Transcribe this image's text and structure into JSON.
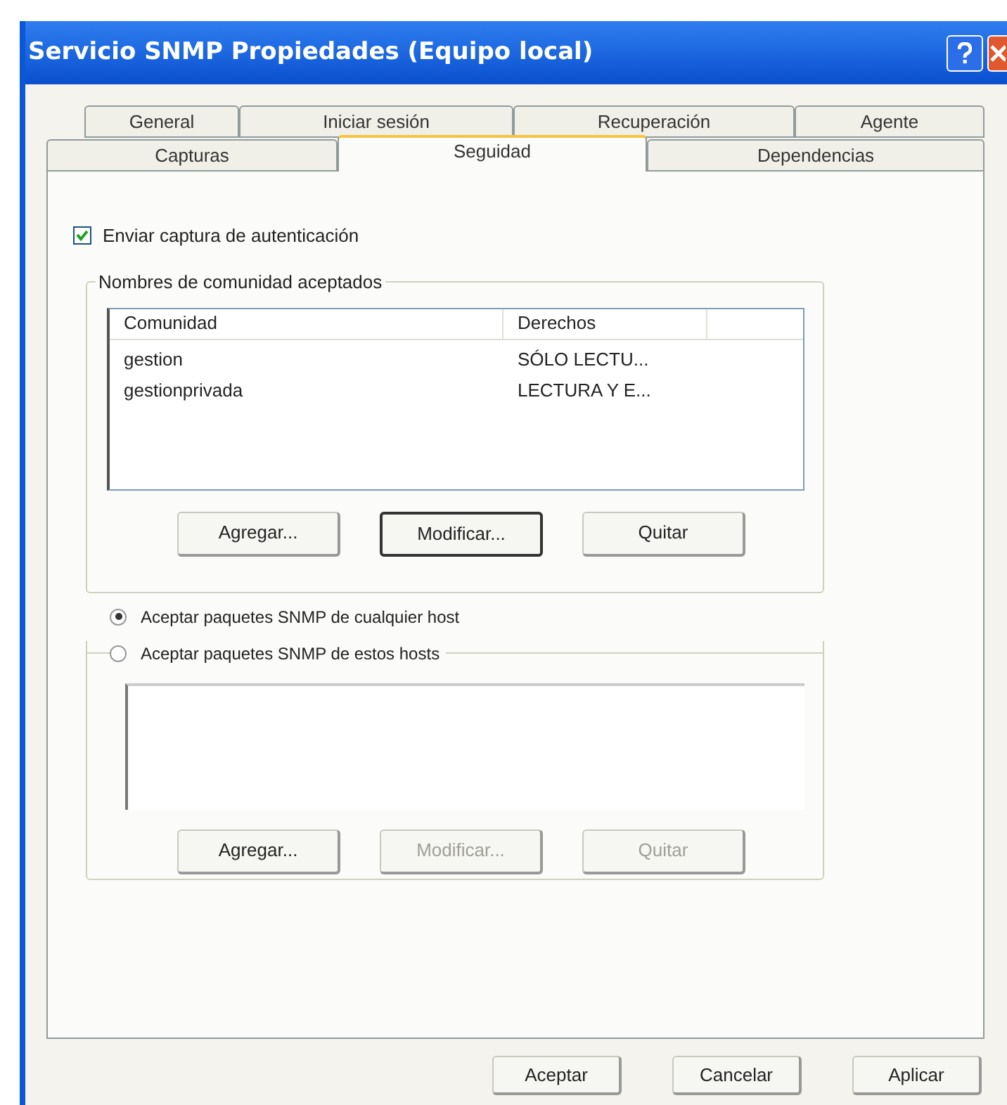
{
  "window": {
    "title": "Servicio SNMP Propiedades (Equipo local)"
  },
  "tab_rows": [
    [
      {
        "label": "General",
        "selected": false
      },
      {
        "label": "Iniciar sesión",
        "selected": false
      },
      {
        "label": "Recuperación",
        "selected": false
      },
      {
        "label": "Agente",
        "selected": false
      }
    ],
    [
      {
        "label": "Capturas",
        "selected": false
      },
      {
        "label": "Seguidad",
        "selected": true
      },
      {
        "label": "Dependencias",
        "selected": false
      }
    ]
  ],
  "auth_trap": {
    "label": "Enviar captura de autenticación",
    "checked": true
  },
  "communities": {
    "title": "Nombres de comunidad aceptados",
    "columns": [
      "Comunidad",
      "Derechos"
    ],
    "rows": [
      [
        "gestion",
        "SÓLO LECTU..."
      ],
      [
        "gestionprivada",
        "LECTURA Y E..."
      ]
    ],
    "buttons": [
      {
        "label": "Agregar...",
        "disabled": false,
        "focused": false
      },
      {
        "label": "Modificar...",
        "disabled": false,
        "focused": true
      },
      {
        "label": "Quitar",
        "disabled": false,
        "focused": false
      }
    ]
  },
  "hosts": {
    "options": [
      {
        "label": "Aceptar paquetes SNMP de cualquier host",
        "selected": true
      },
      {
        "label": "Aceptar paquetes SNMP de estos hosts",
        "selected": false
      }
    ],
    "buttons": [
      {
        "label": "Agregar...",
        "disabled": false,
        "focused": false
      },
      {
        "label": "Modificar...",
        "disabled": true,
        "focused": false
      },
      {
        "label": "Quitar",
        "disabled": true,
        "focused": false
      }
    ]
  },
  "dialog_buttons": [
    {
      "label": "Aceptar",
      "disabled": false,
      "focused": false
    },
    {
      "label": "Cancelar",
      "disabled": false,
      "focused": false
    },
    {
      "label": "Aplicar",
      "disabled": false,
      "focused": false
    }
  ]
}
